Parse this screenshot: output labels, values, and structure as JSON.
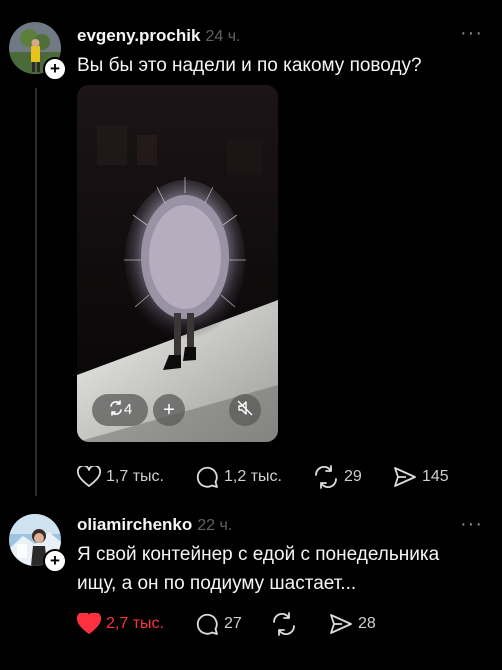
{
  "posts": [
    {
      "username": "evgeny.prochik",
      "time": "24 ч.",
      "text": "Вы бы это надели и по какому поводу?",
      "media": {
        "repost_count": "4"
      },
      "actions": {
        "likes": "1,7 тыс.",
        "comments": "1,2 тыс.",
        "reposts": "29",
        "shares": "145"
      }
    },
    {
      "username": "oliamirchenko",
      "time": "22 ч.",
      "text_lines": [
        "Я свой контейнер с едой с понедельника",
        "ищу, а он по подиуму шастает..."
      ],
      "actions": {
        "likes": "2,7 тыс.",
        "comments": "27",
        "shares": "28"
      }
    }
  ],
  "colors": {
    "background": "#000000",
    "text": "#f3f5f7",
    "muted": "#616161",
    "like_active": "#ff3040"
  },
  "icons": [
    "plus-icon",
    "more-icon",
    "heart-icon",
    "comment-icon",
    "repost-icon",
    "share-icon",
    "mute-icon"
  ]
}
